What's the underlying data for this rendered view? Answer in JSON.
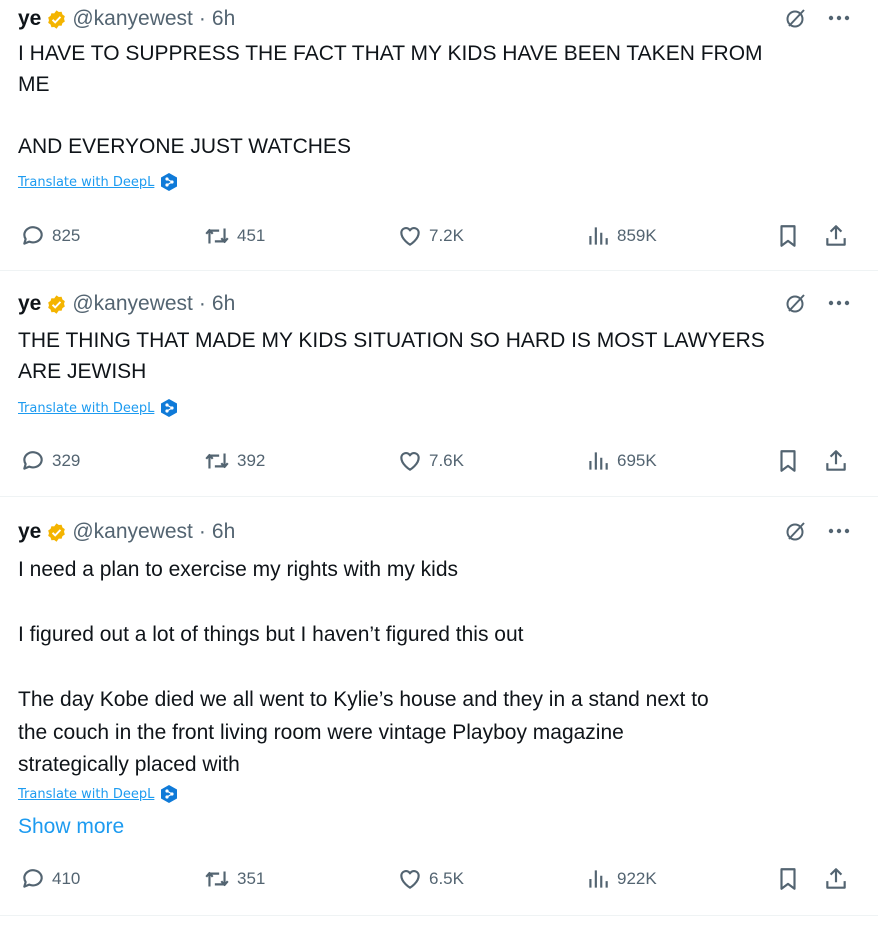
{
  "colors": {
    "accent": "#1d9bf0",
    "badge": "#f4b400",
    "muted": "#536471",
    "text": "#0f1419"
  },
  "icons": {
    "grok": "grok-icon",
    "more": "more-icon",
    "reply": "reply-icon",
    "retweet": "retweet-icon",
    "like": "heart-icon",
    "views": "views-icon",
    "bookmark": "bookmark-icon",
    "share": "share-icon",
    "verified": "verified-badge-icon",
    "deepl": "deepl-icon"
  },
  "tweets": [
    {
      "name": "ye",
      "handle": "@kanyewest",
      "separator": "·",
      "time": "6h",
      "text": "I HAVE TO SUPPRESS THE FACT THAT MY KIDS HAVE BEEN TAKEN FROM\nME\n\nAND EVERYONE JUST WATCHES",
      "translate": "Translate with DeepL",
      "replies": "825",
      "retweets": "451",
      "likes": "7.2K",
      "views": "859K"
    },
    {
      "name": "ye",
      "handle": "@kanyewest",
      "separator": "·",
      "time": "6h",
      "text": "THE THING THAT MADE MY KIDS SITUATION SO HARD IS MOST LAWYERS\nARE JEWISH",
      "translate": "Translate with DeepL",
      "replies": "329",
      "retweets": "392",
      "likes": "7.6K",
      "views": "695K"
    },
    {
      "name": "ye",
      "handle": "@kanyewest",
      "separator": "·",
      "time": "6h",
      "text": "I need a plan to exercise my rights with my kids\n\nI figured out a lot of things but I haven’t figured this out\n\nThe day Kobe died we all went to Kylie’s house and they in a stand next to\nthe couch in the front living room were vintage Playboy magazine\nstrategically placed with",
      "translate": "Translate with DeepL",
      "show_more": "Show more",
      "replies": "410",
      "retweets": "351",
      "likes": "6.5K",
      "views": "922K"
    }
  ]
}
